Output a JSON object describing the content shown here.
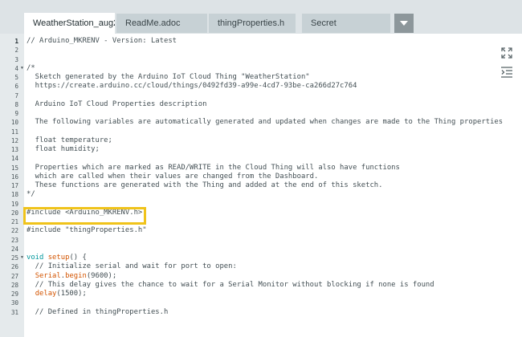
{
  "tabs": [
    {
      "label": "WeatherStation_aug29a",
      "active": true
    },
    {
      "label": "ReadMe.adoc",
      "active": false
    },
    {
      "label": "thingProperties.h",
      "active": false
    },
    {
      "label": "Secret",
      "active": false
    }
  ],
  "tab_more_icon": "chevron-down-icon",
  "side_icons": [
    "expand-icon",
    "indent-icon"
  ],
  "highlight_color": "#f0c31a",
  "active_line": "1",
  "code_lines": [
    {
      "n": "1",
      "segments": [
        {
          "t": "// Arduino_MKRENV - Version: Latest",
          "c": "cmt"
        }
      ]
    },
    {
      "n": "2",
      "segments": []
    },
    {
      "n": "3",
      "segments": []
    },
    {
      "n": "4",
      "fold": true,
      "segments": [
        {
          "t": "/*",
          "c": "cmt"
        }
      ]
    },
    {
      "n": "5",
      "segments": [
        {
          "t": "  Sketch generated by the Arduino IoT Cloud Thing \"WeatherStation\"",
          "c": "cmt"
        }
      ]
    },
    {
      "n": "6",
      "segments": [
        {
          "t": "  https://create.arduino.cc/cloud/things/0492fd39-a99e-4cd7-93be-ca266d27c764",
          "c": "cmt"
        }
      ]
    },
    {
      "n": "7",
      "segments": []
    },
    {
      "n": "8",
      "segments": [
        {
          "t": "  Arduino IoT Cloud Properties description",
          "c": "cmt"
        }
      ]
    },
    {
      "n": "9",
      "segments": []
    },
    {
      "n": "10",
      "segments": [
        {
          "t": "  The following variables are automatically generated and updated when changes are made to the Thing properties",
          "c": "cmt"
        }
      ]
    },
    {
      "n": "11",
      "segments": []
    },
    {
      "n": "12",
      "segments": [
        {
          "t": "  float temperature;",
          "c": "cmt"
        }
      ]
    },
    {
      "n": "13",
      "segments": [
        {
          "t": "  float humidity;",
          "c": "cmt"
        }
      ]
    },
    {
      "n": "14",
      "segments": []
    },
    {
      "n": "15",
      "segments": [
        {
          "t": "  Properties which are marked as READ/WRITE in the Cloud Thing will also have functions",
          "c": "cmt"
        }
      ]
    },
    {
      "n": "16",
      "segments": [
        {
          "t": "  which are called when their values are changed from the Dashboard.",
          "c": "cmt"
        }
      ]
    },
    {
      "n": "17",
      "segments": [
        {
          "t": "  These functions are generated with the Thing and added at the end of this sketch.",
          "c": "cmt"
        }
      ]
    },
    {
      "n": "18",
      "segments": [
        {
          "t": "*/",
          "c": "cmt"
        }
      ]
    },
    {
      "n": "19",
      "segments": []
    },
    {
      "n": "20",
      "highlight": true,
      "segments": [
        {
          "t": "#include <Arduino_MKRENV.h>",
          "c": ""
        }
      ]
    },
    {
      "n": "21",
      "segments": []
    },
    {
      "n": "22",
      "segments": [
        {
          "t": "#include \"thingProperties.h\"",
          "c": ""
        }
      ]
    },
    {
      "n": "23",
      "segments": []
    },
    {
      "n": "24",
      "segments": []
    },
    {
      "n": "25",
      "fold": true,
      "segments": [
        {
          "t": "void",
          "c": "kw"
        },
        {
          "t": " ",
          "c": ""
        },
        {
          "t": "setup",
          "c": "fn"
        },
        {
          "t": "() {",
          "c": ""
        }
      ]
    },
    {
      "n": "26",
      "segments": [
        {
          "t": "  // Initialize serial and wait for port to open:",
          "c": "cmt"
        }
      ]
    },
    {
      "n": "27",
      "segments": [
        {
          "t": "  ",
          "c": ""
        },
        {
          "t": "Serial",
          "c": "fn"
        },
        {
          "t": ".",
          "c": ""
        },
        {
          "t": "begin",
          "c": "fn"
        },
        {
          "t": "(9600);",
          "c": ""
        }
      ]
    },
    {
      "n": "28",
      "segments": [
        {
          "t": "  // This delay gives the chance to wait for a Serial Monitor without blocking if none is found",
          "c": "cmt"
        }
      ]
    },
    {
      "n": "29",
      "segments": [
        {
          "t": "  ",
          "c": ""
        },
        {
          "t": "delay",
          "c": "fn"
        },
        {
          "t": "(1500);",
          "c": ""
        }
      ]
    },
    {
      "n": "30",
      "segments": []
    },
    {
      "n": "31",
      "segments": [
        {
          "t": "  // Defined in thingProperties.h",
          "c": "cmt"
        }
      ]
    }
  ]
}
